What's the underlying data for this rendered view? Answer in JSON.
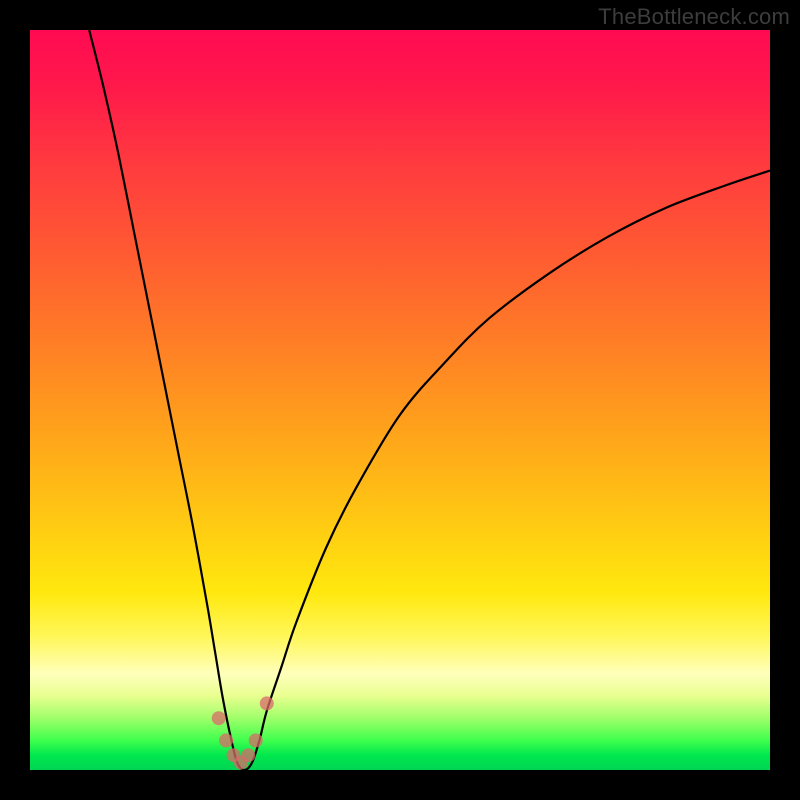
{
  "watermark": "TheBottleneck.com",
  "chart_data": {
    "type": "line",
    "title": "",
    "xlabel": "",
    "ylabel": "",
    "xlim": [
      0,
      100
    ],
    "ylim": [
      0,
      100
    ],
    "grid": false,
    "legend": false,
    "optimum_x": 28,
    "background_gradient": {
      "orientation": "vertical",
      "stops": [
        {
          "pct": 0,
          "color": "#ff0a52"
        },
        {
          "pct": 50,
          "color": "#ff8c1e"
        },
        {
          "pct": 80,
          "color": "#fff23a"
        },
        {
          "pct": 100,
          "color": "#00d453"
        }
      ]
    },
    "series": [
      {
        "name": "bottleneck-curve",
        "color": "#000000",
        "x": [
          8,
          10,
          12,
          14,
          16,
          18,
          20,
          22,
          24,
          25,
          26,
          27,
          28,
          29,
          30,
          31,
          32,
          34,
          36,
          40,
          44,
          50,
          56,
          62,
          70,
          78,
          86,
          94,
          100
        ],
        "y": [
          100,
          92,
          83,
          73,
          63,
          53,
          43,
          33,
          22,
          16,
          10,
          5,
          1,
          0,
          1,
          4,
          8,
          14,
          20,
          30,
          38,
          48,
          55,
          61,
          67,
          72,
          76,
          79,
          81
        ]
      }
    ],
    "markers": {
      "name": "near-optimum-points",
      "color": "#d96a6a",
      "x": [
        25.5,
        26.5,
        27.5,
        28.5,
        29.5,
        30.5,
        32.0
      ],
      "y": [
        7,
        4,
        2,
        1,
        2,
        4,
        9
      ]
    }
  }
}
